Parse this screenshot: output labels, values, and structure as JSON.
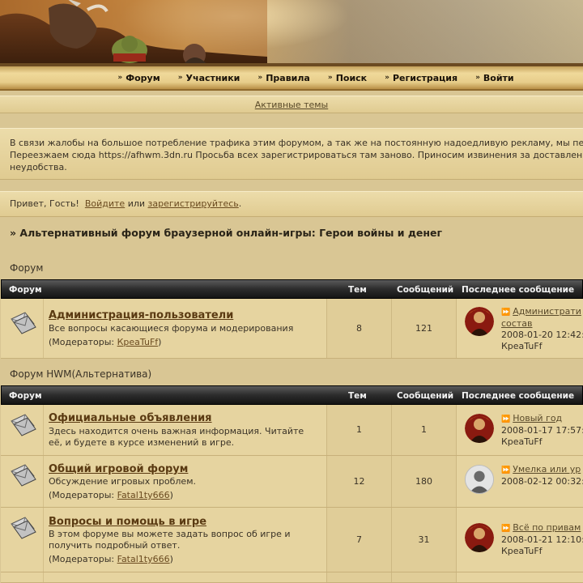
{
  "nav": {
    "items": [
      {
        "label": "Форум"
      },
      {
        "label": "Участники"
      },
      {
        "label": "Правила"
      },
      {
        "label": "Поиск"
      },
      {
        "label": "Регистрация"
      },
      {
        "label": "Войти"
      }
    ]
  },
  "active_topics": "Активные темы",
  "notice": {
    "line1": "В связи жалобы на большое потребление трафика этим форумом, а так же на постоянную надоедливую рекламу, мы пе",
    "line2": "Переезжаем сюда https://afhwm.3dn.ru Просьба всех зарегистрироваться там заново. Приносим извинения за доставлени",
    "line3": "неудобства."
  },
  "greeting": {
    "prefix": "Привет, Гость!",
    "login": "Войдите",
    "or": "или",
    "register": "зарегистрируйтесь",
    "suffix": "."
  },
  "forum_title": "» Альтернативный форум браузерной онлайн-игры: Герои войны и денег",
  "columns": {
    "forum": "Форум",
    "topics": "Тем",
    "posts": "Сообщений",
    "last": "Последнее сообщение"
  },
  "sections": [
    {
      "label": "Форум",
      "rows": [
        {
          "title": "Администрация-пользователи",
          "desc": "Все вопросы касающиеся форума и модерирования",
          "mod_prefix": "(Модераторы:",
          "mod_name": "КреаTuFf",
          "mod_suffix": ")",
          "topics": "8",
          "posts": "121",
          "last_link": "Администрати",
          "last_link2": "состав",
          "last_date": "2008-01-20 12:42:",
          "last_user": "КреаTuFf"
        }
      ]
    },
    {
      "label": "Форум HWM(Альтернатива)",
      "rows": [
        {
          "title": "Официальные объявления",
          "desc1": "Здесь находится очень важная информация. Читайте",
          "desc2": "её, и будете в курсе изменений в игре.",
          "topics": "1",
          "posts": "1",
          "last_link": "Новый год",
          "last_date": "2008-01-17 17:57:",
          "last_user": "КреаTuFf"
        },
        {
          "title": "Общий игровой форум",
          "desc": "Обсуждение игровых проблем.",
          "mod_prefix": "(Модераторы:",
          "mod_name": "Fatal1ty666",
          "mod_suffix": ")",
          "topics": "12",
          "posts": "180",
          "last_link": "Умелка или ур",
          "last_date": "2008-02-12 00:32:"
        },
        {
          "title": "Вопросы и помощь в игре",
          "desc1": "В этом форуме вы можете задать вопрос об игре и",
          "desc2": "получить подробный ответ.",
          "mod_prefix": "(Модераторы:",
          "mod_name": "Fatal1ty666",
          "mod_suffix": ")",
          "topics": "7",
          "posts": "31",
          "last_link": "Всё по привам",
          "last_date": "2008-01-21 12:10:",
          "last_user": "КреаTuFf"
        }
      ]
    }
  ],
  "colors": {
    "page_bg": "#d9c694",
    "header_dark": "#1e1e1e",
    "link": "#5a3a12"
  }
}
